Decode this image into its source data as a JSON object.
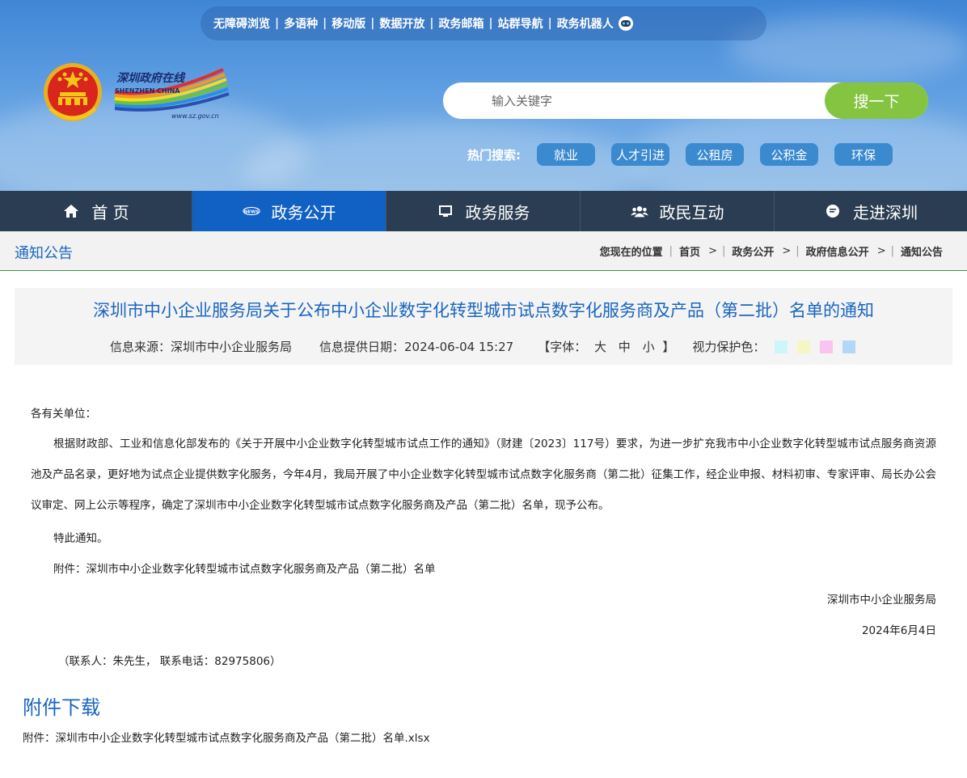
{
  "topbar": {
    "links": [
      "无障碍浏览",
      "多语种",
      "移动版",
      "数据开放",
      "政务邮箱",
      "站群导航",
      "政务机器人"
    ]
  },
  "logo": {
    "cn": "深圳政府在线",
    "en": "SHENZHEN CHINA",
    "url": "www.sz.gov.cn"
  },
  "search": {
    "placeholder": "输入关键字",
    "button": "搜一下"
  },
  "hot": {
    "label": "热门搜索:",
    "tags": [
      "就业",
      "人才引进",
      "公租房",
      "公积金",
      "环保"
    ]
  },
  "nav": {
    "items": [
      {
        "label": "首 页",
        "icon": "home-icon"
      },
      {
        "label": "政务公开",
        "icon": "news-icon"
      },
      {
        "label": "政务服务",
        "icon": "monitor-icon"
      },
      {
        "label": "政民互动",
        "icon": "people-icon"
      },
      {
        "label": "走进深圳",
        "icon": "chat-icon"
      }
    ],
    "active_index": 1
  },
  "crumbbar": {
    "section": "通知公告",
    "location_label": "您现在的位置",
    "path": [
      "首页",
      "政务公开",
      "政府信息公开",
      "通知公告"
    ]
  },
  "article": {
    "title": "深圳市中小企业服务局关于公布中小企业数字化转型城市试点数字化服务商及产品（第二批）名单的通知",
    "source": "信息来源：深圳市中小企业服务局",
    "date": "信息提供日期：2024-06-04 15:27",
    "font_label": "【字体：",
    "font_sizes": [
      "大",
      "中",
      "小"
    ],
    "font_close": "】",
    "eye_label": "视力保护色：",
    "swatches": [
      "#cdf6fb",
      "#f6f6c4",
      "#f9c5f0",
      "#b3d7f7"
    ],
    "salutation": "各有关单位：",
    "body": "根据财政部、工业和信息化部发布的《关于开展中小企业数字化转型城市试点工作的通知》（财建〔2023〕117号）要求，为进一步扩充我市中小企业数字化转型城市试点服务商资源池及产品名录，更好地为试点企业提供数字化服务，今年4月，我局开展了中小企业数字化转型城市试点数字化服务商（第二批）征集工作，经企业申报、材料初审、专家评审、局长办公会议审定、网上公示等程序，确定了深圳市中小企业数字化转型城市试点数字化服务商及产品（第二批）名单，现予公布。",
    "notice": "特此通知。",
    "attachment": "附件：深圳市中小企业数字化转型城市试点数字化服务商及产品（第二批）名单",
    "signer": "深圳市中小企业服务局",
    "sign_date": "2024年6月4日",
    "contact": "（联系人：朱先生， 联系电话：82975806）"
  },
  "download": {
    "title": "附件下载",
    "file": "附件：深圳市中小企业数字化转型城市试点数字化服务商及产品（第二批）名单.xlsx"
  }
}
